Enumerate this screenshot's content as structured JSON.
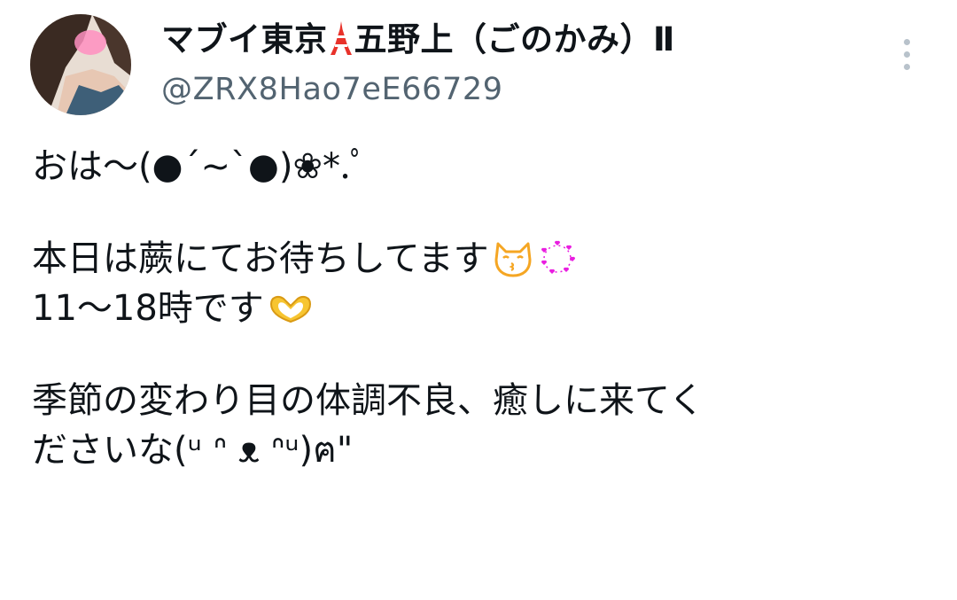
{
  "tweet": {
    "author": {
      "name_part1": "マブイ東京",
      "name_part2": "五野上（ごのかみ）Ⅱ",
      "handle": "@ZRX8Hao7eE66729"
    },
    "lines": [
      "おは〜(●´~`●)❀*.ﾟ",
      "本日は蕨にてお待ちしてます",
      "11〜18時です",
      "季節の変わり目の体調不良、癒しに来てく",
      "ださいな(ᵘ ᐢ ᴥ ᐢᵘ)ฅ\""
    ]
  },
  "colors": {
    "text": "#0f1419",
    "secondary": "#536471",
    "more_dots": "#b8c2cb",
    "emoji_cat": "#f5a623",
    "emoji_hearts": "#e91ee0",
    "emoji_hands": "#f7c531"
  },
  "icons": {
    "tower": "tokyo-tower-emoji",
    "cat": "kissing-cat-emoji",
    "hearts": "heart-ring-emoji",
    "hands": "heart-hands-emoji",
    "more": "vertical-ellipsis-icon"
  }
}
